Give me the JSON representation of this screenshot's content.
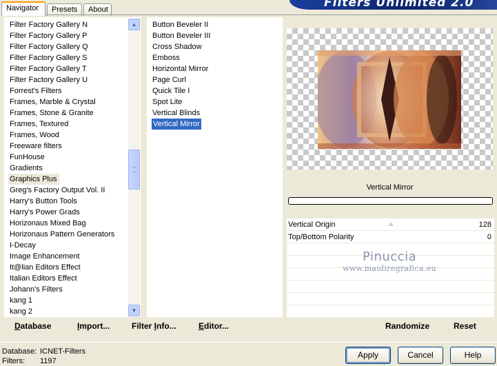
{
  "tabs": [
    {
      "label": "Navigator"
    },
    {
      "label": "Presets"
    },
    {
      "label": "About"
    }
  ],
  "app_title": "Filters Unlimited 2.0",
  "categories": [
    "Filter Factory Gallery N",
    "Filter Factory Gallery P",
    "Filter Factory Gallery Q",
    "Filter Factory Gallery S",
    "Filter Factory Gallery T",
    "Filter Factory Gallery U",
    "Forrest's Filters",
    "Frames, Marble & Crystal",
    "Frames, Stone & Granite",
    "Frames, Textured",
    "Frames, Wood",
    "Freeware filters",
    "FunHouse",
    "Gradients",
    "Graphics Plus",
    "Greg's Factory Output Vol. II",
    "Harry's Button Tools",
    "Harry's Power Grads",
    "Horizonaus Mixed Bag",
    "Horizonaus Pattern Generators",
    "I-Decay",
    "Image Enhancement",
    "It@lian Editors Effect",
    "Italian Editors Effect",
    "Johann's Filters",
    "kang 1",
    "kang 2"
  ],
  "selected_category": "Graphics Plus",
  "filters": [
    "Button Beveler II",
    "Button Beveler III",
    "Cross Shadow",
    "Emboss",
    "Horizontal Mirror",
    "Page Curl",
    "Quick Tile I",
    "Spot Lite",
    "Vertical Blinds",
    "Vertical Mirror"
  ],
  "selected_filter": "Vertical Mirror",
  "filter_name": "Vertical Mirror",
  "parameters": [
    {
      "label": "Vertical Origin",
      "value": "128"
    },
    {
      "label": "Top/Bottom Polarity",
      "value": "0"
    }
  ],
  "watermark": {
    "name": "Pinuccia",
    "url": "www.maidiregrafica.eu"
  },
  "links": {
    "database": "Database",
    "import": "Import...",
    "filter_info": "Filter Info...",
    "editor": "Editor...",
    "randomize": "Randomize",
    "reset": "Reset"
  },
  "status": {
    "database_label": "Database:",
    "database_value": "ICNET-Filters",
    "filters_label": "Filters:",
    "filters_value": "1197"
  },
  "buttons": {
    "apply": "Apply",
    "cancel": "Cancel",
    "help": "Help"
  }
}
